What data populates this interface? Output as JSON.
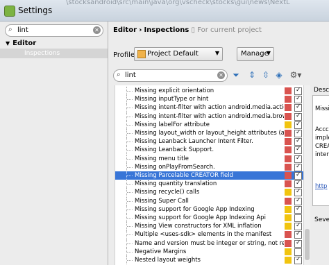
{
  "window": {
    "title": "Settings",
    "ghost_text": "\\stocksandroid\\src\\main\\java\\org\\vscheck\\stocks\\gui\\news\\NextL"
  },
  "sidebar": {
    "search_value": "lint",
    "tree_root": "Editor",
    "tree_child": "Inspections"
  },
  "header": {
    "breadcrumb_root": "Editor",
    "separator": "›",
    "breadcrumb_page": "Inspections",
    "scope_text": "For current project"
  },
  "profile": {
    "label": "Profile:",
    "value": "Project Default",
    "manage_label": "Manage"
  },
  "inspection_search": {
    "value": "lint"
  },
  "colors": {
    "error": "#d9534f",
    "warning": "#f1c40f",
    "selection": "#3875d7"
  },
  "inspections": [
    {
      "name": "Missing explicit orientation",
      "severity": "error",
      "checked": true
    },
    {
      "name": "Missing inputType or hint",
      "severity": "error",
      "checked": true
    },
    {
      "name": "Missing intent-filter with action android.media.action.MEDI",
      "severity": "error",
      "checked": true
    },
    {
      "name": "Missing intent-filter with action android.media.browse.Med",
      "severity": "error",
      "checked": true
    },
    {
      "name": "Missing labelFor attribute",
      "severity": "warning",
      "checked": true
    },
    {
      "name": "Missing layout_width or layout_height attributes (available",
      "severity": "error",
      "checked": true
    },
    {
      "name": "Missing Leanback Launcher Intent Filter.",
      "severity": "error",
      "checked": true
    },
    {
      "name": "Missing Leanback Support.",
      "severity": "error",
      "checked": true
    },
    {
      "name": "Missing menu title",
      "severity": "error",
      "checked": true
    },
    {
      "name": "Missing onPlayFromSearch.",
      "severity": "error",
      "checked": true
    },
    {
      "name": "Missing Parcelable CREATOR field",
      "severity": "error",
      "checked": true,
      "selected": true
    },
    {
      "name": "Missing quantity translation",
      "severity": "error",
      "checked": true
    },
    {
      "name": "Missing recycle() calls",
      "severity": "warning",
      "checked": true
    },
    {
      "name": "Missing Super Call",
      "severity": "error",
      "checked": true
    },
    {
      "name": "Missing support for Google App Indexing",
      "severity": "warning",
      "checked": true
    },
    {
      "name": "Missing support for Google App Indexing Api",
      "severity": "warning",
      "checked": false
    },
    {
      "name": "Missing View constructors for XML inflation",
      "severity": "warning",
      "checked": true
    },
    {
      "name": "Multiple <uses-sdk> elements in the manifest",
      "severity": "error",
      "checked": true
    },
    {
      "name": "Name and version must be integer or string, not resource",
      "severity": "error",
      "checked": true
    },
    {
      "name": "Negative Margins",
      "severity": "warning",
      "checked": false
    },
    {
      "name": "Nested layout weights",
      "severity": "warning",
      "checked": true
    }
  ],
  "description": {
    "label": "Descri",
    "lines": [
      "Missi",
      "",
      "Accc",
      "imple",
      "CREAT",
      "inter",
      "",
      "",
      "http"
    ],
    "severity_label": "Sever"
  }
}
